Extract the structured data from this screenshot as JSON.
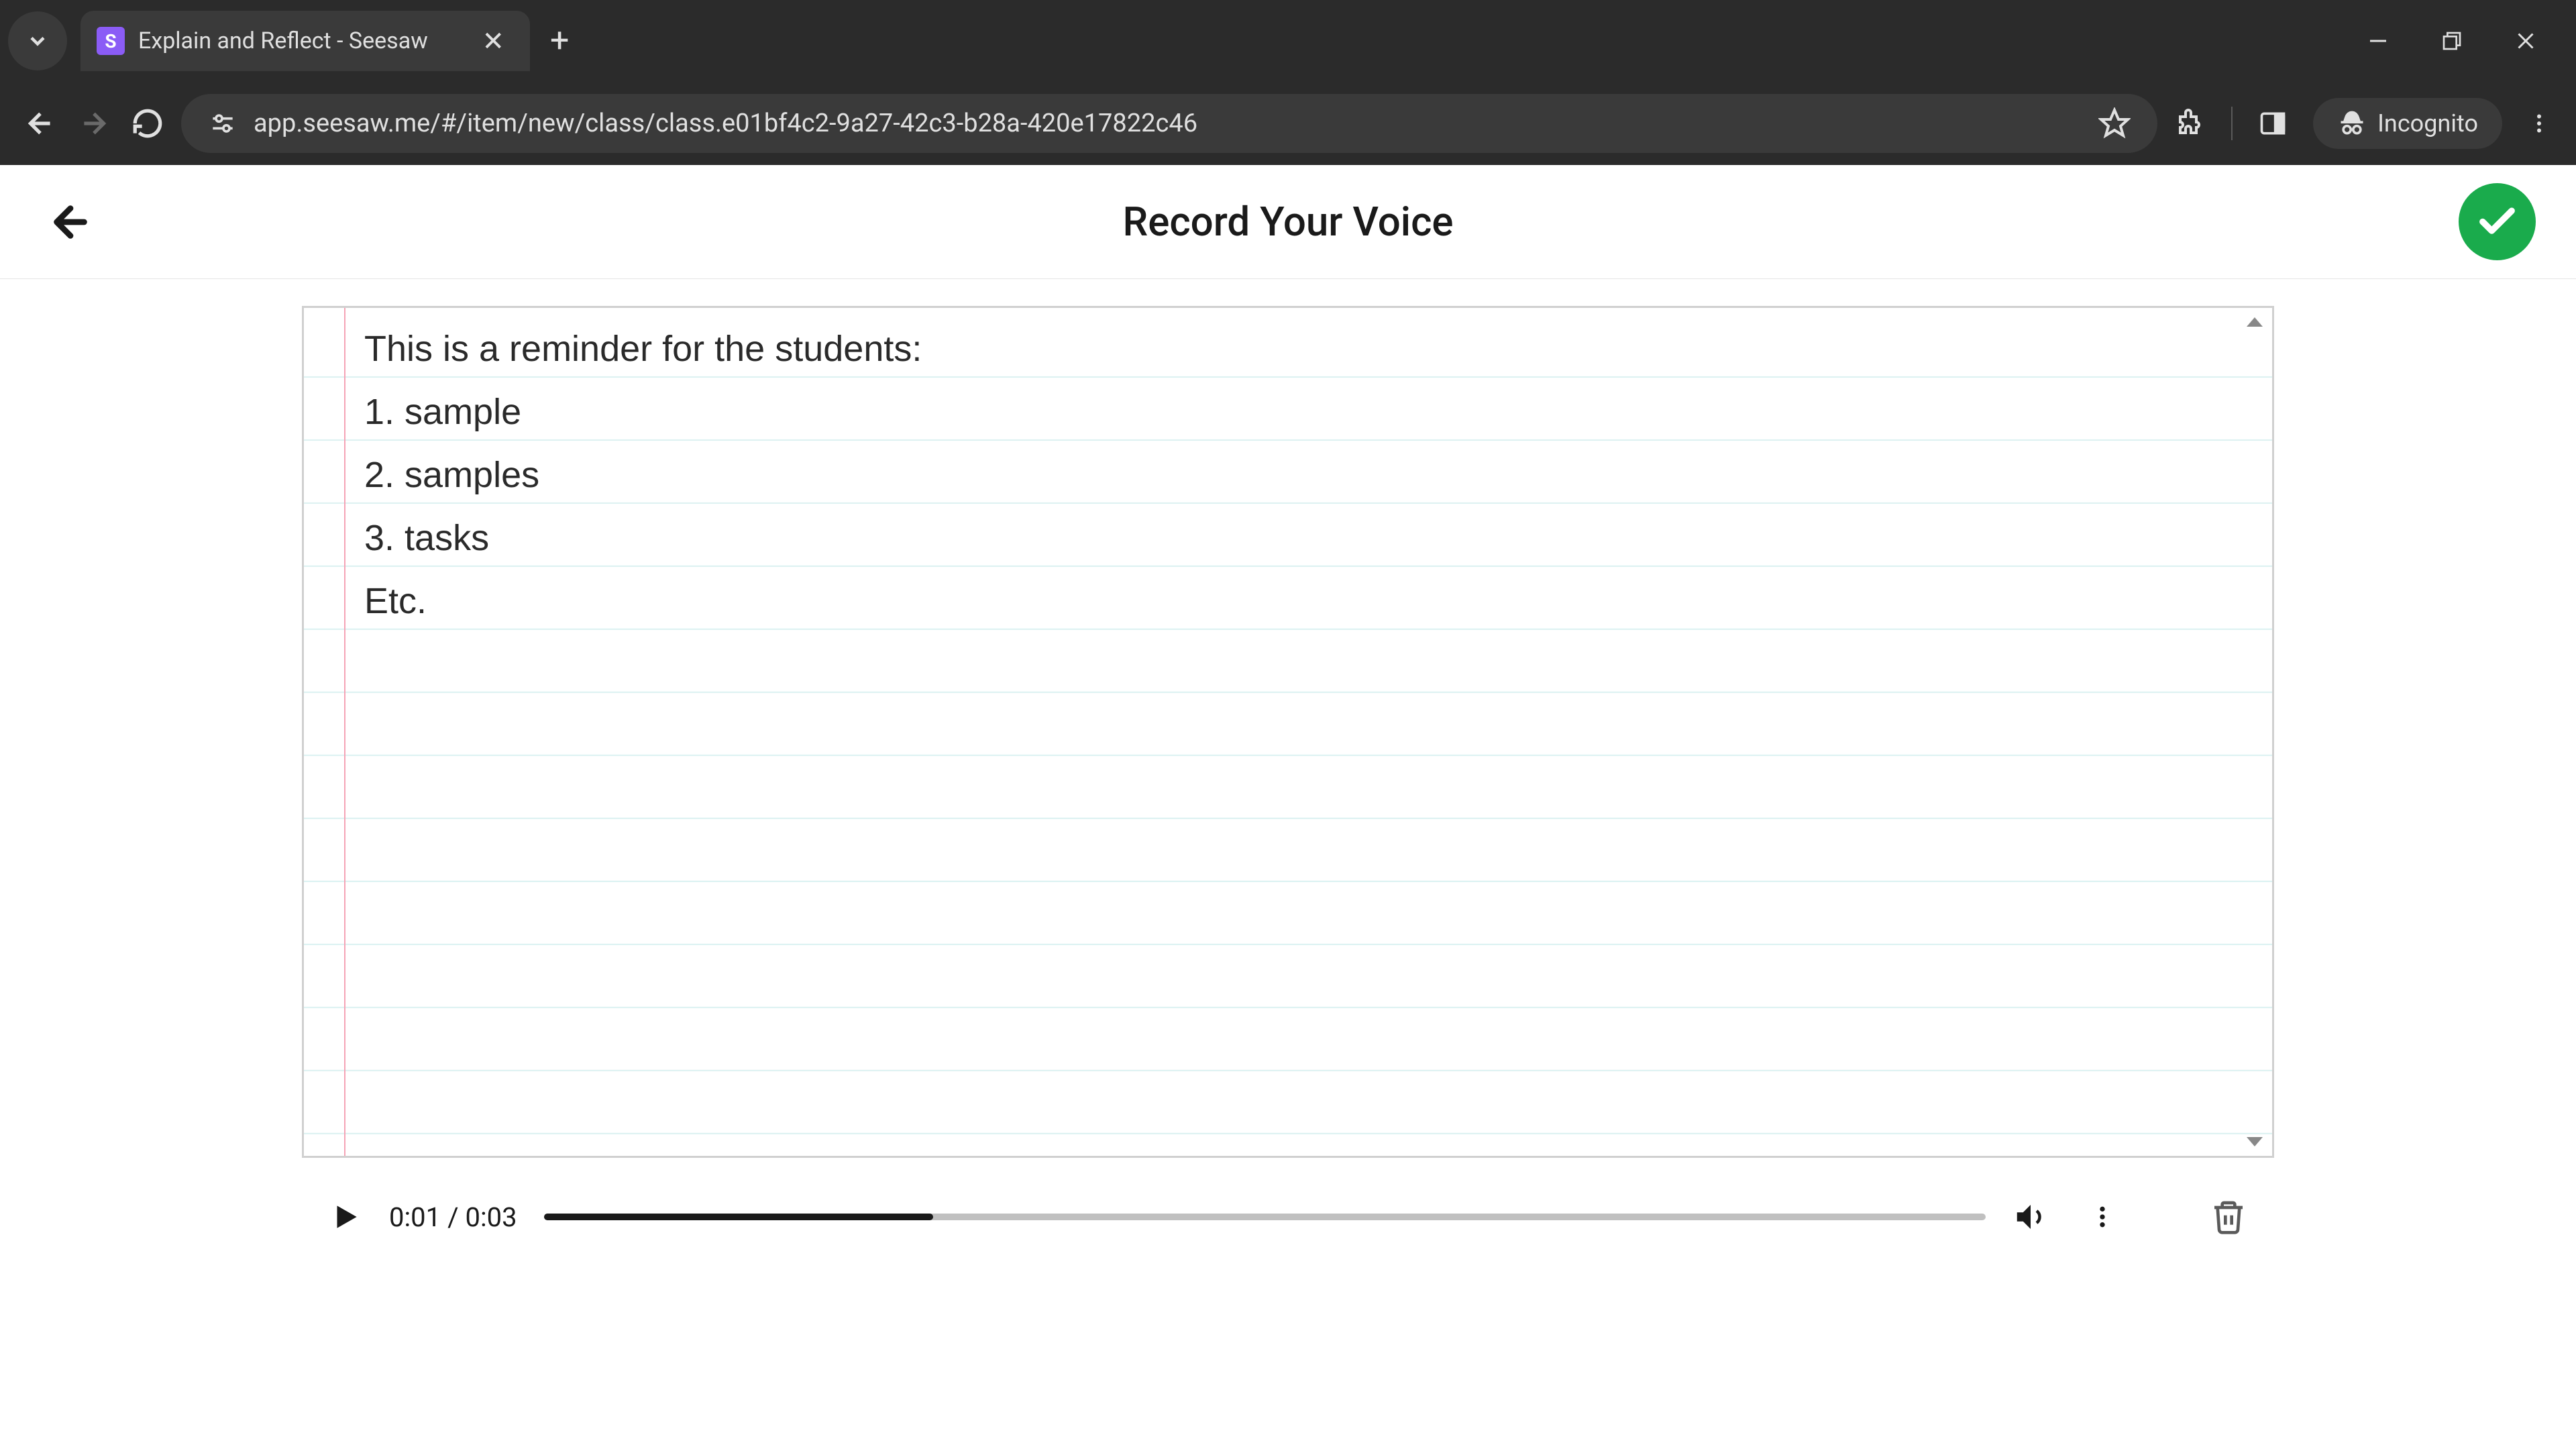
{
  "browser": {
    "tab": {
      "title": "Explain and Reflect - Seesaw",
      "favicon_letter": "S"
    },
    "url": "app.seesaw.me/#/item/new/class/class.e01bf4c2-9a27-42c3-b28a-420e17822c46",
    "incognito_label": "Incognito"
  },
  "app": {
    "page_title": "Record Your Voice",
    "note": {
      "lines": [
        "This is a reminder for the students:",
        "1. sample",
        "2. samples",
        "3. tasks",
        "Etc."
      ]
    },
    "audio": {
      "current_time": "0:01",
      "total_time": "0:03",
      "progress_percent": 27
    }
  },
  "colors": {
    "confirm_green": "#1aab4c",
    "favicon_purple": "#8b5cf6",
    "margin_pink": "#f5a3b5"
  }
}
